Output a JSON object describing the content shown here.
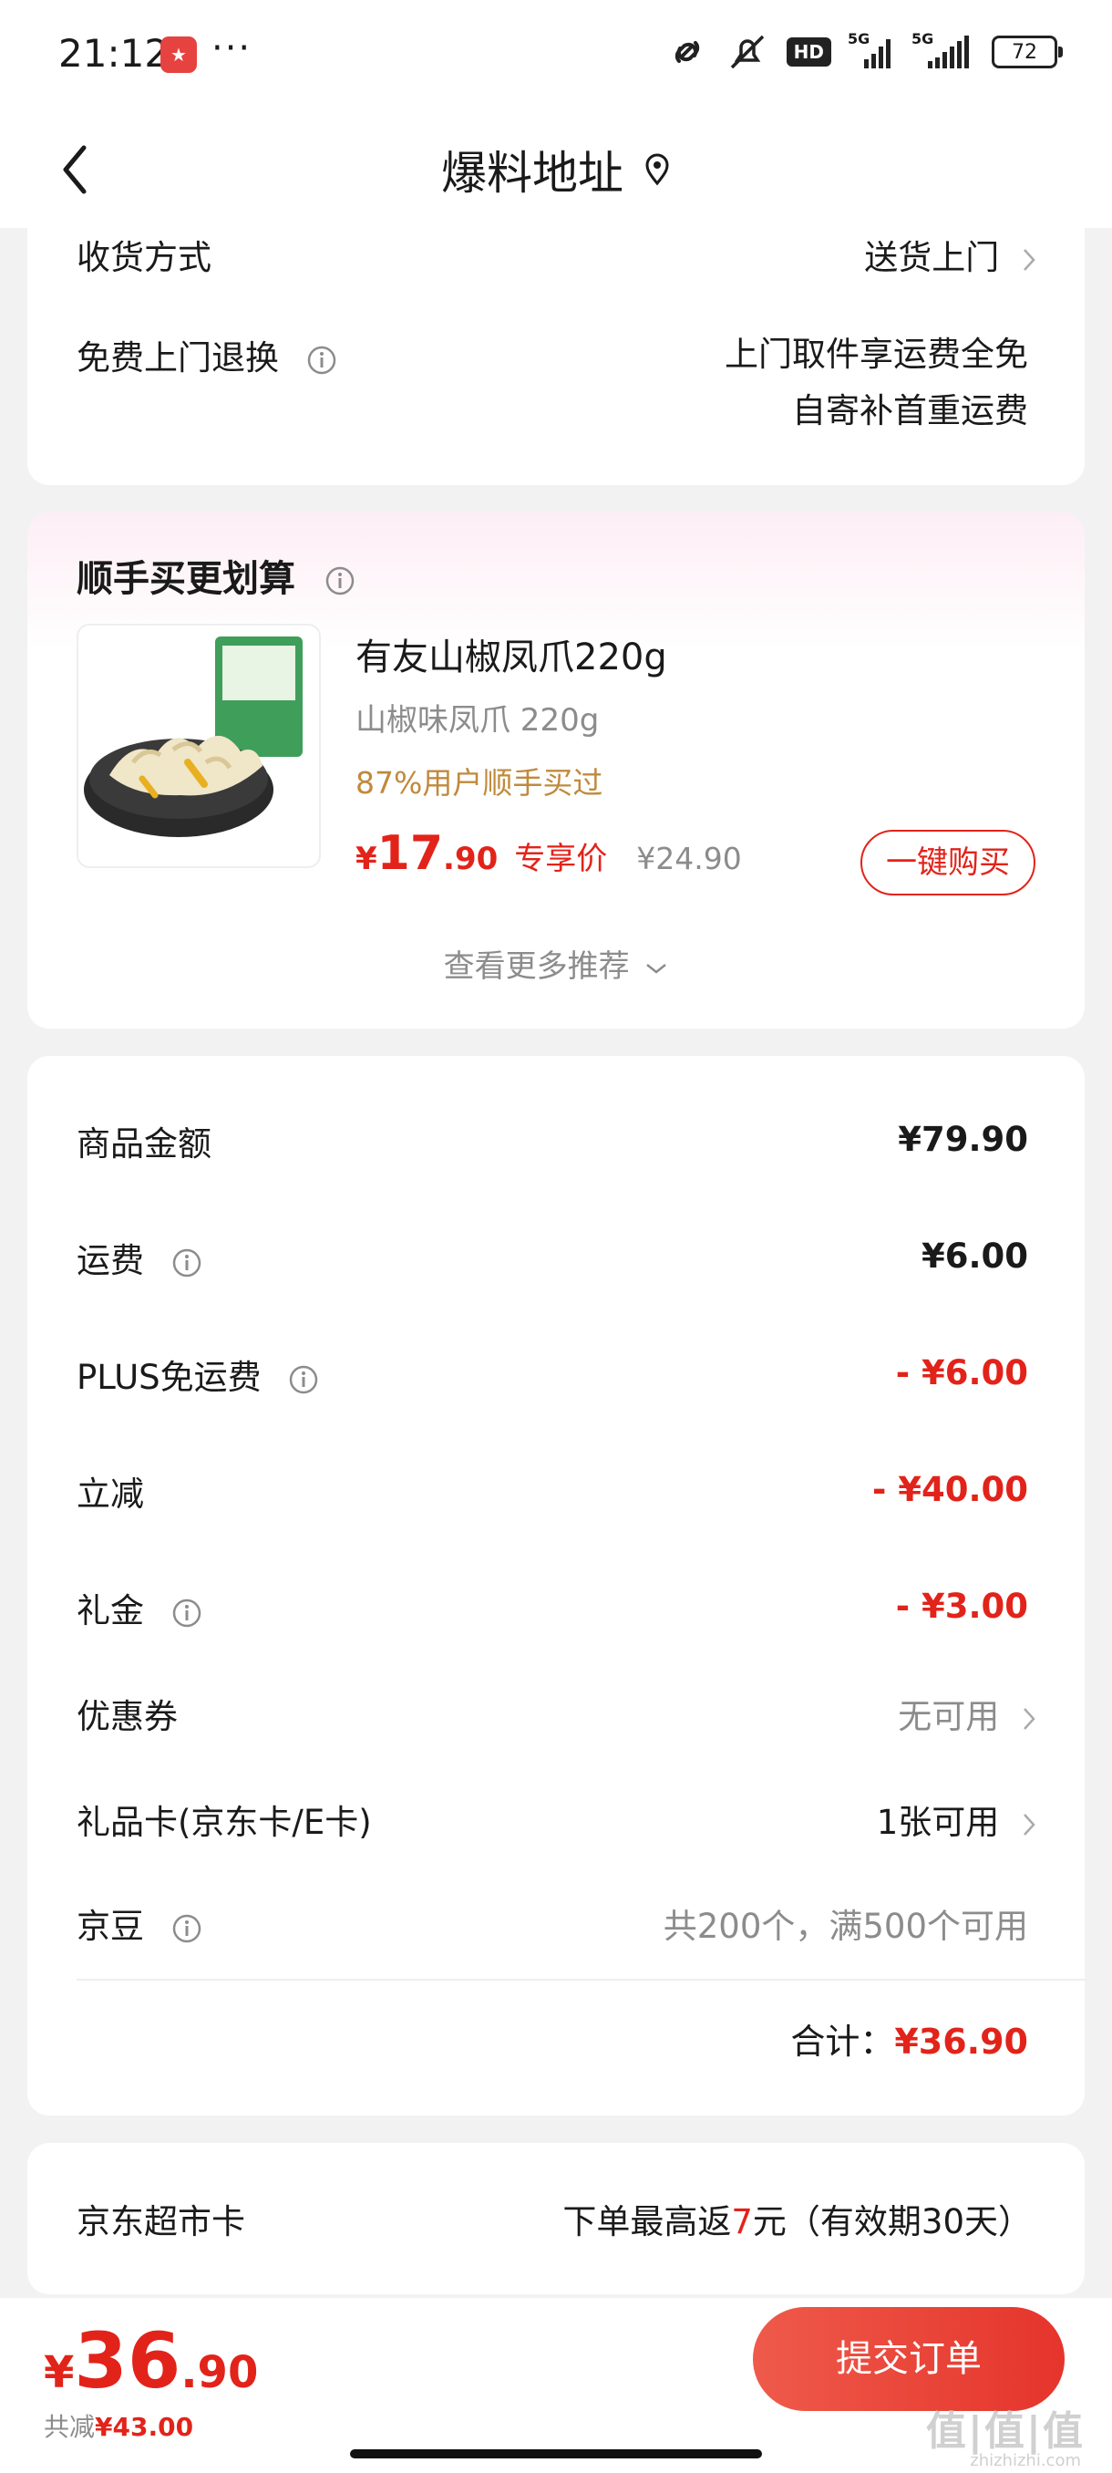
{
  "status_bar": {
    "time": "21:12",
    "dots": "···",
    "battery": "72",
    "hd": "HD",
    "net1": "5G",
    "net2": "5G"
  },
  "header": {
    "title": "爆料地址"
  },
  "delivery": {
    "method_label": "收货方式",
    "method_value": "送货上门",
    "return_label": "免费上门退换",
    "return_value_line1": "上门取件享运费全免",
    "return_value_line2": "自寄补首重运费"
  },
  "recommend": {
    "title": "顺手买更划算",
    "product_name": "有友山椒凤爪220g",
    "product_spec": "山椒味凤爪 220g",
    "hint": "87%用户顺手买过",
    "price_currency": "¥",
    "price_int": "17",
    "price_dec": ".90",
    "price_tag": "专享价",
    "price_old": "¥24.90",
    "buy_label": "一键购买",
    "more_label": "查看更多推荐"
  },
  "summary": {
    "goods_label": "商品金额",
    "goods_value": "¥79.90",
    "shipping_label": "运费",
    "shipping_value": "¥6.00",
    "plus_label": "PLUS免运费",
    "plus_value": "- ¥6.00",
    "discount_label": "立减",
    "discount_value": "- ¥40.00",
    "gift_label": "礼金",
    "gift_value": "- ¥3.00",
    "coupon_label": "优惠券",
    "coupon_value": "无可用",
    "giftcard_label": "礼品卡(京东卡/E卡)",
    "giftcard_value": "1张可用",
    "beans_label": "京豆",
    "beans_value": "共200个，满500个可用",
    "total_label": "合计：",
    "total_value": "¥36.90"
  },
  "supermarket": {
    "label": "京东超市卡",
    "value_prefix": "下单最高返",
    "value_num": "7",
    "value_suffix": "元（有效期30天）"
  },
  "bottom": {
    "pay_currency": "¥",
    "pay_int": "36",
    "pay_dec": ".90",
    "reduce_label": "共减",
    "reduce_value": "¥43.00",
    "submit_label": "提交订单",
    "watermark": "值|值|值",
    "watermark_sub": "zhizhizhi.com"
  },
  "colors": {
    "accent": "#e2231a",
    "hint": "#c08a3c",
    "background": "#f2f2f2"
  }
}
